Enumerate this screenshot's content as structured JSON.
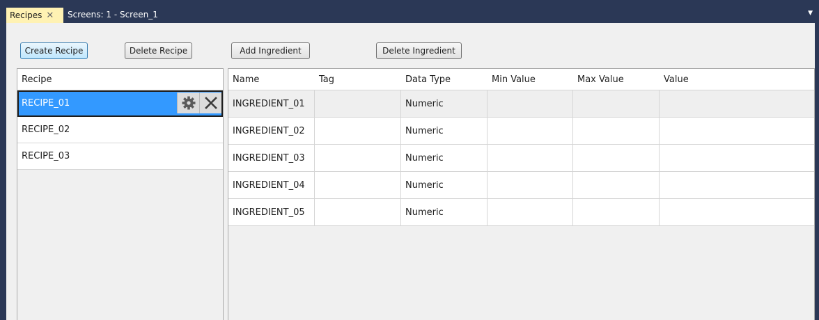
{
  "tabs": {
    "active_label": "Recipes",
    "close_glyph": "✕",
    "inactive_label": "Screens: 1 - Screen_1",
    "dropdown_glyph": "▼"
  },
  "toolbar": {
    "create_recipe": "Create Recipe",
    "delete_recipe": "Delete Recipe",
    "add_ingredient": "Add Ingredient",
    "delete_ingredient": "Delete Ingredient"
  },
  "recipes": {
    "header": "Recipe",
    "items": [
      {
        "name": "RECIPE_01",
        "selected": true
      },
      {
        "name": "RECIPE_02",
        "selected": false
      },
      {
        "name": "RECIPE_03",
        "selected": false
      }
    ],
    "row_actions": {
      "settings_icon": "gear-icon",
      "delete_icon": "close-icon"
    }
  },
  "ingredients": {
    "columns": [
      "Name",
      "Tag",
      "Data Type",
      "Min Value",
      "Max Value",
      "Value"
    ],
    "rows": [
      [
        "INGREDIENT_01",
        "",
        "Numeric",
        "",
        "",
        ""
      ],
      [
        "INGREDIENT_02",
        "",
        "Numeric",
        "",
        "",
        ""
      ],
      [
        "INGREDIENT_03",
        "",
        "Numeric",
        "",
        "",
        ""
      ],
      [
        "INGREDIENT_04",
        "",
        "Numeric",
        "",
        "",
        ""
      ],
      [
        "INGREDIENT_05",
        "",
        "Numeric",
        "",
        "",
        ""
      ]
    ]
  },
  "colors": {
    "title_bar": "#2b3856",
    "active_tab": "#fff2b3",
    "selection": "#3399ff",
    "panel_bg": "#f0f0f0"
  }
}
